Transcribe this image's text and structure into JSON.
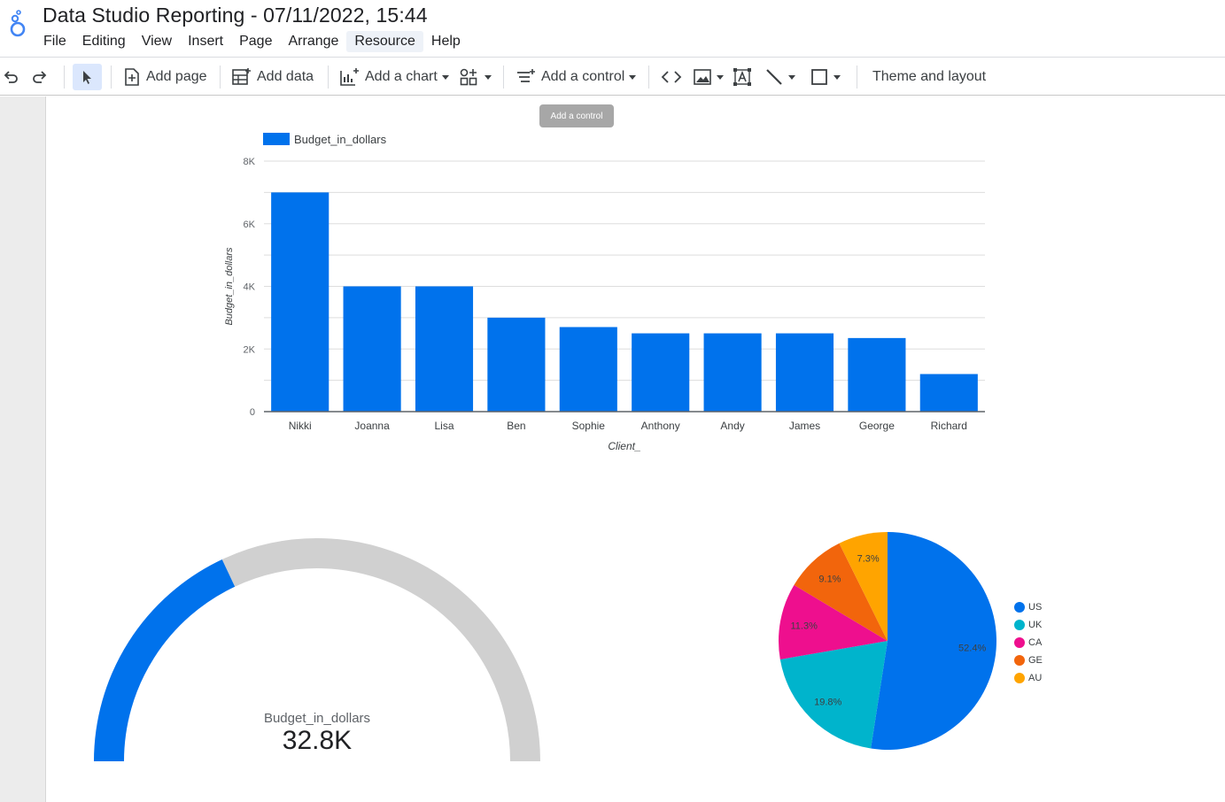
{
  "title": "Data Studio Reporting - 07/11/2022, 15:44",
  "menu": [
    "File",
    "Editing",
    "View",
    "Insert",
    "Page",
    "Arrange",
    "Resource",
    "Help"
  ],
  "toolbar": {
    "add_page": "Add page",
    "add_data": "Add data",
    "add_chart": "Add a chart",
    "add_control": "Add a control",
    "theme_layout": "Theme and layout"
  },
  "tooltip": "Add a control",
  "colors": {
    "primary": "#0072ec",
    "gauge_track": "#d0d0d0",
    "pie": [
      "#0072ec",
      "#00b4cc",
      "#ee0f8e",
      "#f2650c",
      "#ffa400"
    ]
  },
  "chart_data": [
    {
      "type": "bar",
      "legend": [
        "Budget_in_dollars"
      ],
      "legend_position": "top-left",
      "xlabel": "Client_",
      "ylabel": "Budget_in_dollars",
      "categories": [
        "Nikki",
        "Joanna",
        "Lisa",
        "Ben",
        "Sophie",
        "Anthony",
        "Andy",
        "James",
        "George",
        "Richard"
      ],
      "values": [
        7000,
        4000,
        4000,
        3000,
        2700,
        2500,
        2500,
        2500,
        2350,
        1200
      ],
      "ylim": [
        0,
        8000
      ],
      "yticks": [
        0,
        2000,
        4000,
        6000,
        8000
      ],
      "ytick_labels": [
        "0",
        "2K",
        "4K",
        "6K",
        "8K"
      ],
      "grid": true
    },
    {
      "type": "gauge",
      "label": "Budget_in_dollars",
      "value_label": "32.8K",
      "fill_fraction": 0.36
    },
    {
      "type": "pie",
      "legend_position": "right",
      "categories": [
        "US",
        "UK",
        "CA",
        "GE",
        "AU"
      ],
      "values": [
        52.4,
        19.8,
        11.3,
        9.1,
        7.3
      ],
      "labels": [
        "52.4%",
        "19.8%",
        "11.3%",
        "9.1%",
        "7.3%"
      ]
    }
  ]
}
